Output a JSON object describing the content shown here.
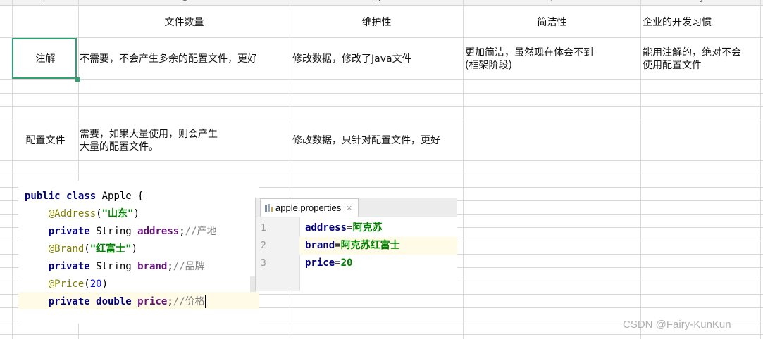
{
  "column_headers": [
    "F",
    "G",
    "H",
    "I",
    "J"
  ],
  "table": {
    "headers": [
      "文件数量",
      "维护性",
      "简洁性",
      "企业的开发习惯"
    ],
    "rows": [
      {
        "label": "注解",
        "file_count": "不需要，不会产生多余的配置文件，更好",
        "maintainability": "修改数据，修改了Java文件",
        "conciseness": "更加简洁，虽然现在体会不到\n(框架阶段)",
        "enterprise_habit": "能用注解的，绝对不会\n使用配置文件"
      },
      {
        "label": "配置文件",
        "file_count": "需要，如果大量使用，则会产生\n大量的配置文件。",
        "maintainability": "修改数据，只针对配置文件，更好",
        "conciseness": "",
        "enterprise_habit": ""
      }
    ]
  },
  "code_editor": {
    "lines": [
      {
        "kw": "public class",
        "rest": " Apple {"
      },
      {
        "ann": "@Address",
        "open": "(",
        "str": "\"山东\"",
        "close": ")"
      },
      {
        "kw": "private",
        "type": " String ",
        "field": "address",
        "semi": ";",
        "comment": "//产地"
      },
      {
        "ann": "@Brand",
        "open": "(",
        "str": "\"红富士\"",
        "close": ")"
      },
      {
        "kw": "private",
        "type": " String ",
        "field": "brand",
        "semi": ";",
        "comment": "//品牌"
      },
      {
        "ann": "@Price",
        "open": "(",
        "num": "20",
        "close": ")"
      },
      {
        "kw": "private double",
        "type": " ",
        "field": "price",
        "semi": ";",
        "comment": "//价格"
      }
    ]
  },
  "properties_editor": {
    "tab_label": "apple.properties",
    "tab_close": "×",
    "lines": [
      {
        "num": "1",
        "key": "address",
        "eq": "=",
        "value": "阿克苏"
      },
      {
        "num": "2",
        "key": "brand",
        "eq": "=",
        "value": "阿克苏红富士"
      },
      {
        "num": "3",
        "key": "price",
        "eq": "=",
        "value": "20"
      }
    ]
  },
  "watermark": "CSDN @Fairy-KunKun",
  "colors": {
    "selection": "#2aa473",
    "grid": "#d8d8d8",
    "keyword": "#000080",
    "string": "#008000",
    "annotation": "#808000",
    "field": "#660e7a"
  }
}
